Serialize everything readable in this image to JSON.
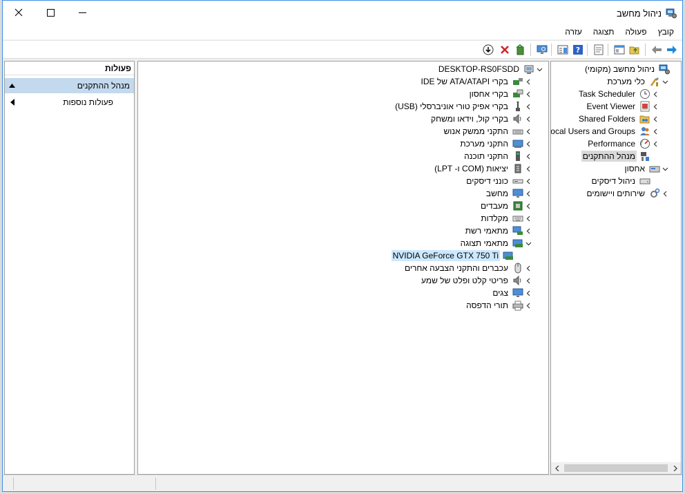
{
  "window": {
    "title": "ניהול מחשב",
    "close_label": "×"
  },
  "menu": [
    "קובץ",
    "פעולה",
    "תצוגה",
    "עזרה"
  ],
  "toolbar": {
    "icons": [
      "forward-icon",
      "back-icon",
      "up-folder-icon",
      "show-hide-tree-icon",
      "properties-icon",
      "help-icon",
      "view-icon",
      "monitor-icon",
      "enable-driver-icon",
      "uninstall-icon",
      "download-icon"
    ],
    "colors": {
      "back_forward": "#1e88d6",
      "uninstall_red": "#d3232a"
    }
  },
  "left_tree": {
    "items": [
      {
        "label": "ניהול מחשב (מקומי)",
        "icon": "computer-management-icon",
        "expander": ""
      },
      {
        "label": "כלי מערכת",
        "icon": "tools-icon",
        "expander": "expanded"
      },
      {
        "label": "Task Scheduler",
        "icon": "clock-icon",
        "expander": "collapsed"
      },
      {
        "label": "Event Viewer",
        "icon": "event-viewer-icon",
        "expander": "collapsed"
      },
      {
        "label": "Shared Folders",
        "icon": "shared-folders-icon",
        "expander": "collapsed"
      },
      {
        "label": "Local Users and Groups",
        "icon": "users-icon",
        "expander": "collapsed"
      },
      {
        "label": "Performance",
        "icon": "performance-icon",
        "expander": "collapsed"
      },
      {
        "label": "מנהל ההתקנים",
        "icon": "device-manager-icon",
        "expander": "",
        "selected": true
      },
      {
        "label": "אחסון",
        "icon": "storage-icon",
        "expander": "expanded"
      },
      {
        "label": "ניהול דיסקים",
        "icon": "disk-icon",
        "expander": ""
      },
      {
        "label": "שירותים ויישומים",
        "icon": "services-icon",
        "expander": "collapsed"
      }
    ]
  },
  "device_tree": {
    "root": {
      "label": "DESKTOP-RS0FSDD",
      "icon": "computer-icon"
    },
    "items": [
      {
        "label": "בקרי ATA/ATAPI של IDE",
        "icon": "ide-controller-icon",
        "expander": "collapsed"
      },
      {
        "label": "בקרי אחסון",
        "icon": "storage-controller-icon",
        "expander": "collapsed"
      },
      {
        "label": "בקרי אפיק טורי אוניברסלי (USB)",
        "icon": "usb-icon",
        "expander": "collapsed"
      },
      {
        "label": "בקרי קול, וידאו ומשחק",
        "icon": "speaker-icon",
        "expander": "collapsed"
      },
      {
        "label": "התקני ממשק אנוש",
        "icon": "hid-icon",
        "expander": "collapsed"
      },
      {
        "label": "התקני מערכת",
        "icon": "system-devices-icon",
        "expander": "collapsed"
      },
      {
        "label": "התקני תוכנה",
        "icon": "software-device-icon",
        "expander": "collapsed"
      },
      {
        "label": "יציאות (COM ו- LPT)",
        "icon": "port-icon",
        "expander": "collapsed"
      },
      {
        "label": "כונני דיסקים",
        "icon": "disk-drive-icon",
        "expander": "collapsed"
      },
      {
        "label": "מחשב",
        "icon": "monitor-icon",
        "expander": "collapsed"
      },
      {
        "label": "מעבדים",
        "icon": "processor-icon",
        "expander": "collapsed"
      },
      {
        "label": "מקלדות",
        "icon": "keyboard-icon",
        "expander": "collapsed"
      },
      {
        "label": "מתאמי רשת",
        "icon": "network-adapter-icon",
        "expander": "collapsed"
      },
      {
        "label": "מתאמי תצוגה",
        "icon": "display-adapter-icon",
        "expander": "expanded"
      },
      {
        "label": "NVIDIA GeForce GTX 750 Ti",
        "icon": "display-adapter-icon",
        "expander": "",
        "child": true,
        "highlight": true
      },
      {
        "label": "עכברים והתקני הצבעה אחרים",
        "icon": "mouse-icon",
        "expander": "collapsed"
      },
      {
        "label": "פריטי קלט ופלט של שמע",
        "icon": "speaker-icon",
        "expander": "collapsed"
      },
      {
        "label": "צגים",
        "icon": "monitor-icon",
        "expander": "collapsed"
      },
      {
        "label": "תורי הדפסה",
        "icon": "printer-icon",
        "expander": "collapsed"
      }
    ]
  },
  "actions": {
    "header": "פעולות",
    "items": [
      {
        "label": "מנהל ההתקנים",
        "expander": "up",
        "selected": true
      },
      {
        "label": "פעולות נוספות",
        "expander": "right"
      }
    ],
    "colors": {
      "section_bg": "#c3d9ee"
    }
  }
}
